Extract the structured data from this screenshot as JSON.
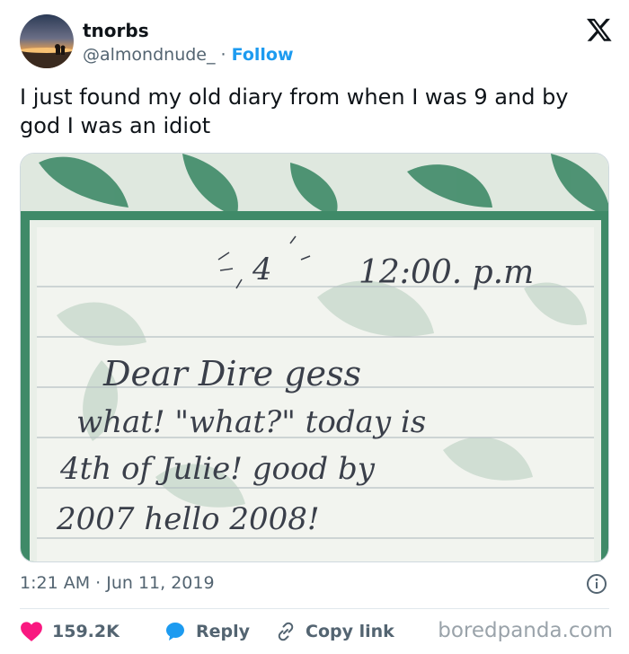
{
  "tweet": {
    "display_name": "tnorbs",
    "handle": "@almondnude_",
    "separator": "·",
    "follow_label": "Follow",
    "text": "I just found my old diary from when I was 9 and by god I was an idiot",
    "timestamp": "1:21 AM · Jun 11, 2019"
  },
  "photo": {
    "diary_lines": [
      "4",
      "12:00. p.m",
      "Dear Dire gess",
      "what! \"what?\" today is",
      "4th of Julie! good by",
      "2007 hello 2008!"
    ]
  },
  "actions": {
    "likes_count": "159.2K",
    "reply_label": "Reply",
    "copy_link_label": "Copy link"
  },
  "watermark": "boredpanda.com",
  "colors": {
    "accent": "#1d9bf0",
    "like": "#f91880",
    "muted": "#536471",
    "paper_frame": "#3f8a68"
  },
  "icons": {
    "brand": "x-logo-icon",
    "info": "info-icon",
    "like": "heart-icon",
    "reply": "speech-bubble-icon",
    "copy": "link-icon"
  }
}
